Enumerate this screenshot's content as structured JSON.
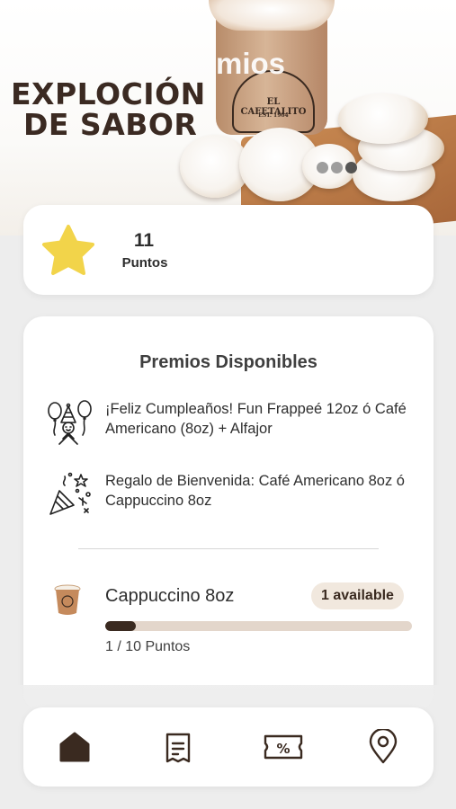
{
  "banner": {
    "headline_line1": "EXPLOCIÓN",
    "headline_line2": "DE SABOR",
    "overlay_text": "mios",
    "cup_brand": "EL CAFETALITO",
    "cup_est": "EST. 1964",
    "slides": 3,
    "active_slide": 3
  },
  "points": {
    "value": "11",
    "label": "Puntos",
    "star_color": "#f2d44a"
  },
  "rewards": {
    "title": "Premios Disponibles",
    "items": [
      {
        "icon": "balloons-party-icon",
        "text": "¡Feliz Cumpleaños! Fun Frappeé 12oz ó Café Americano (8oz) + Alfajor"
      },
      {
        "icon": "confetti-party-icon",
        "text": "Regalo de Bienvenida: Café Americano 8oz  ó  Cappuccino 8oz"
      }
    ]
  },
  "loyalty": {
    "product": "Cappuccino 8oz",
    "badge": "1 available",
    "progress_text": "1 / 10 Puntos",
    "progress_fraction": 0.1,
    "bar_color": "#3a2a20",
    "track_color": "#e3d6cb"
  },
  "nav": {
    "items": [
      {
        "icon": "home-icon",
        "active": true
      },
      {
        "icon": "receipt-icon",
        "active": false
      },
      {
        "icon": "discount-ticket-icon",
        "active": false
      },
      {
        "icon": "location-pin-icon",
        "active": false
      }
    ],
    "color": "#3a2a20"
  },
  "colors": {
    "brand_dark": "#3a2a20",
    "card_bg": "#ffffff",
    "page_bg": "#ededed"
  }
}
